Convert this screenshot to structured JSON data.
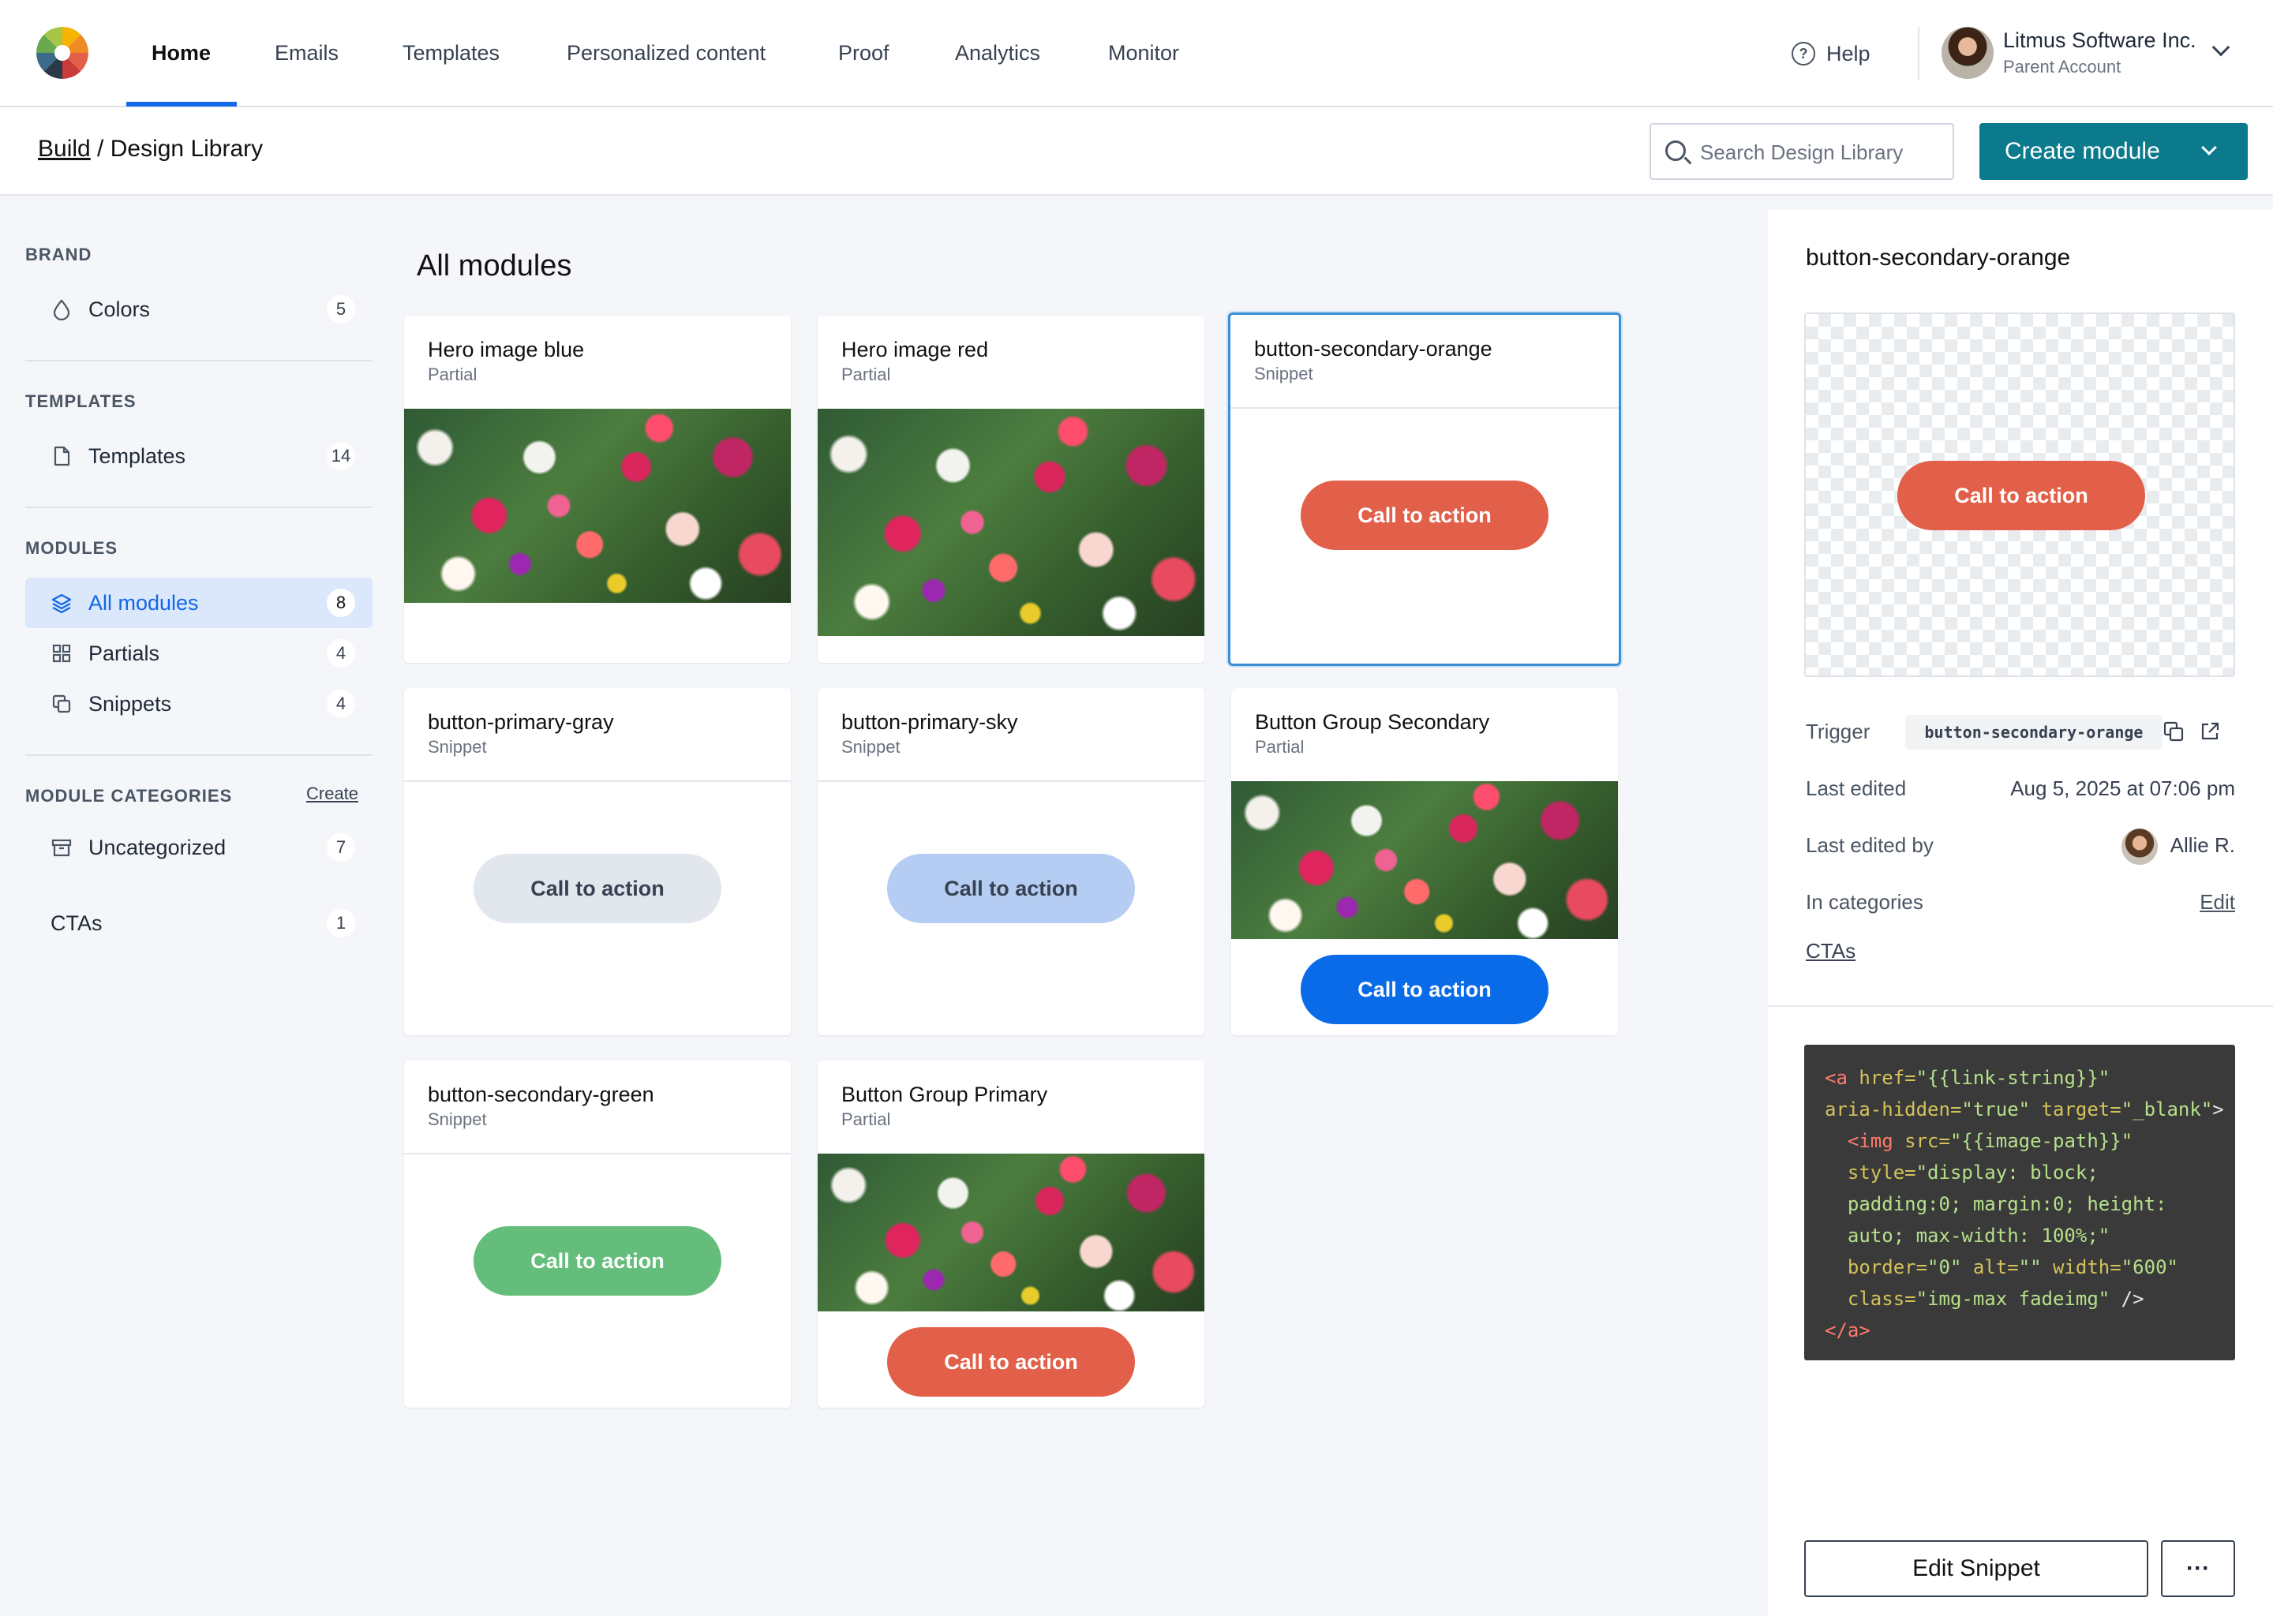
{
  "nav": {
    "tabs": [
      {
        "label": "Home"
      },
      {
        "label": "Emails"
      },
      {
        "label": "Templates"
      },
      {
        "label": "Personalized content"
      },
      {
        "label": "Proof"
      },
      {
        "label": "Analytics"
      },
      {
        "label": "Monitor"
      }
    ],
    "help_label": "Help",
    "account_name": "Litmus Software Inc.",
    "account_sub": "Parent Account"
  },
  "breadcrumb": {
    "root": "Build",
    "separator": " / ",
    "current": "Design Library"
  },
  "search": {
    "placeholder": "Search Design Library"
  },
  "create_button": "Create module",
  "sidebar": {
    "brand_title": "BRAND",
    "colors": {
      "label": "Colors",
      "count": "5"
    },
    "templates_title": "TEMPLATES",
    "templates": {
      "label": "Templates",
      "count": "14"
    },
    "modules_title": "MODULES",
    "modules": [
      {
        "label": "All modules",
        "count": "8"
      },
      {
        "label": "Partials",
        "count": "4"
      },
      {
        "label": "Snippets",
        "count": "4"
      }
    ],
    "categories_title": "MODULE CATEGORIES",
    "create_link": "Create",
    "categories": [
      {
        "label": "Uncategorized",
        "count": "7"
      },
      {
        "label": "CTAs",
        "count": "1"
      }
    ]
  },
  "main": {
    "title": "All modules",
    "cards": [
      {
        "title": "Hero image blue",
        "type": "Partial"
      },
      {
        "title": "Hero image red",
        "type": "Partial"
      },
      {
        "title": "button-secondary-orange",
        "type": "Snippet",
        "cta": "Call to action"
      },
      {
        "title": "button-primary-gray",
        "type": "Snippet",
        "cta": "Call to action"
      },
      {
        "title": "button-primary-sky",
        "type": "Snippet",
        "cta": "Call to action"
      },
      {
        "title": "Button Group Secondary",
        "type": "Partial",
        "cta": "Call to action"
      },
      {
        "title": "button-secondary-green",
        "type": "Snippet",
        "cta": "Call to action"
      },
      {
        "title": "Button Group Primary",
        "type": "Partial",
        "cta": "Call to action"
      }
    ]
  },
  "colors": {
    "accent": "#1167e8",
    "create_button": "#0b7a8c",
    "cta_orange": "#e2604a",
    "cta_gray": "#e2e6ed",
    "cta_sky": "#b5cdf3",
    "cta_blue": "#0a6be8",
    "cta_green": "#64bd7a"
  },
  "detail": {
    "title": "button-secondary-orange",
    "preview_cta": "Call to action",
    "trigger_label": "Trigger",
    "trigger_value": "button-secondary-orange",
    "last_edited_label": "Last edited",
    "last_edited_value": "Aug 5, 2025 at 07:06 pm",
    "last_edited_by_label": "Last edited by",
    "last_edited_by_value": "Allie R.",
    "categories_label": "In categories",
    "edit_link": "Edit",
    "category": "CTAs",
    "code": {
      "l1a": "<a",
      "l1b": " href=",
      "l1c": "\"{{link-string}}\"",
      "l2a": "aria-hidden=",
      "l2b": "\"true\"",
      "l2c": " target=",
      "l2d": "\"_blank\"",
      "l2e": ">",
      "l3a": "  <img",
      "l3b": " src=",
      "l3c": "\"{{image-path}}\"",
      "l4a": "  style=",
      "l4b": "\"display: block;",
      "l5a": "  padding:0; margin:0; height:",
      "l6a": "  auto; max-width: 100%;\"",
      "l7a": "  border=",
      "l7b": "\"0\"",
      "l7c": " alt=",
      "l7d": "\"\"",
      "l7e": " width=",
      "l7f": "\"600\"",
      "l8a": "  class=",
      "l8b": "\"img-max fadeimg\"",
      "l8c": " />",
      "l9a": "</a>"
    },
    "edit_button": "Edit Snippet",
    "more_button": "···"
  },
  "icons": [
    "litmus-logo",
    "help-icon",
    "chevron-down-icon",
    "search-icon",
    "drop-icon",
    "document-icon",
    "layers-icon",
    "grid-icon",
    "copy-icon",
    "archive-icon",
    "external-link-icon"
  ]
}
